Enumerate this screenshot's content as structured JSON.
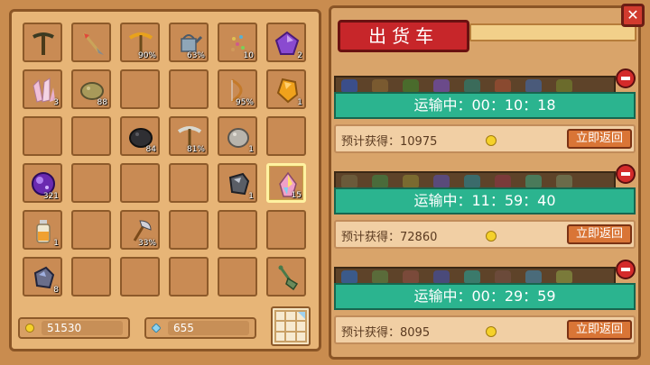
{
  "inventory": {
    "slots": [
      {
        "icon": "pickaxe-dark-icon",
        "count": ""
      },
      {
        "icon": "feather-spear-icon",
        "count": ""
      },
      {
        "icon": "golden-pickaxe-icon",
        "count": "90%"
      },
      {
        "icon": "watering-can-icon",
        "count": "63%"
      },
      {
        "icon": "seeds-icon",
        "count": "10"
      },
      {
        "icon": "purple-gem-icon",
        "count": "2"
      },
      {
        "icon": "pink-crystal-icon",
        "count": "3"
      },
      {
        "icon": "olive-stone-icon",
        "count": "88"
      },
      {
        "icon": "",
        "count": ""
      },
      {
        "icon": "",
        "count": ""
      },
      {
        "icon": "bow-icon",
        "count": "95%"
      },
      {
        "icon": "amber-gem-icon",
        "count": "1"
      },
      {
        "icon": "",
        "count": ""
      },
      {
        "icon": "",
        "count": ""
      },
      {
        "icon": "coal-icon",
        "count": "84"
      },
      {
        "icon": "pickaxe-icon",
        "count": "81%"
      },
      {
        "icon": "gray-stone-icon",
        "count": "1"
      },
      {
        "icon": "",
        "count": ""
      },
      {
        "icon": "purple-orb-icon",
        "count": "321"
      },
      {
        "icon": "",
        "count": ""
      },
      {
        "icon": "",
        "count": ""
      },
      {
        "icon": "",
        "count": ""
      },
      {
        "icon": "iron-ore-icon",
        "count": "1"
      },
      {
        "icon": "rainbow-crystal-icon",
        "count": "15"
      },
      {
        "icon": "potion-bottle-icon",
        "count": "1"
      },
      {
        "icon": "",
        "count": ""
      },
      {
        "icon": "axe-icon",
        "count": "33%"
      },
      {
        "icon": "",
        "count": ""
      },
      {
        "icon": "",
        "count": ""
      },
      {
        "icon": "",
        "count": ""
      },
      {
        "icon": "blue-ore-icon",
        "count": "8"
      },
      {
        "icon": "",
        "count": ""
      },
      {
        "icon": "",
        "count": ""
      },
      {
        "icon": "",
        "count": ""
      },
      {
        "icon": "",
        "count": ""
      },
      {
        "icon": "shovel-icon",
        "count": ""
      }
    ],
    "selected_index": 23
  },
  "currency": {
    "gold": "51530",
    "gems": "655"
  },
  "shipping": {
    "title": "出货车",
    "close_label": "✕",
    "carts": [
      {
        "status": "运输中：00：10：18",
        "expected_label": "预计获得：10975",
        "recall_label": "立即返回"
      },
      {
        "status": "运输中：11：59：40",
        "expected_label": "预计获得：72860",
        "recall_label": "立即返回"
      },
      {
        "status": "运输中：00：29：59",
        "expected_label": "预计获得：8095",
        "recall_label": "立即返回"
      }
    ]
  },
  "colors": {
    "panel": "#e7b577",
    "teal_status": "#2bb48f",
    "title_red": "#c7262a",
    "coin_gold": "#f5d12a"
  }
}
